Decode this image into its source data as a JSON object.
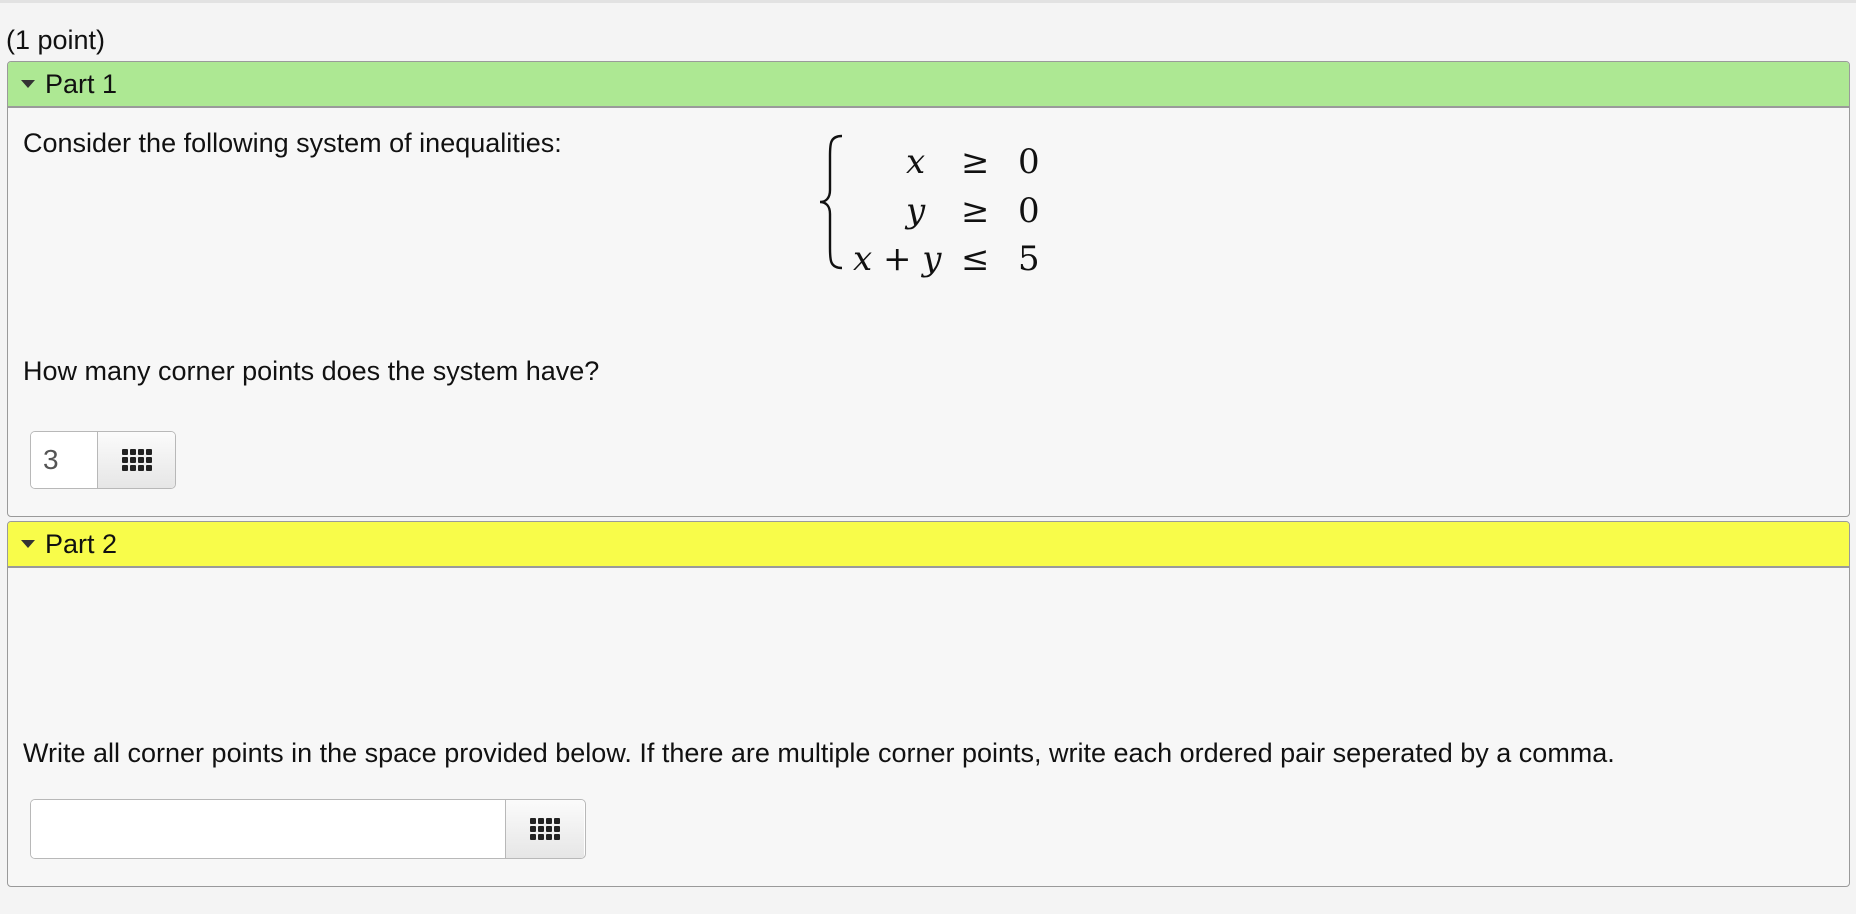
{
  "points_label": "(1 point)",
  "part1": {
    "title": "Part 1",
    "intro": "Consider the following system of inequalities:",
    "system": [
      {
        "lhs": "x",
        "op": "≥",
        "rhs": "0"
      },
      {
        "lhs": "y",
        "op": "≥",
        "rhs": "0"
      },
      {
        "lhs": "x + y",
        "op": "≤",
        "rhs": "5"
      }
    ],
    "question": "How many corner points does the system have?",
    "answer_value": "3",
    "keypad_icon": "grid-keypad-icon"
  },
  "part2": {
    "title": "Part 2",
    "instruction": "Write all corner points in the space provided below. If there are multiple corner points, write each ordered pair seperated by a comma.",
    "answer_value": "",
    "keypad_icon": "grid-keypad-icon"
  },
  "colors": {
    "part1_header": "#ade893",
    "part2_header": "#f8fc4a"
  }
}
